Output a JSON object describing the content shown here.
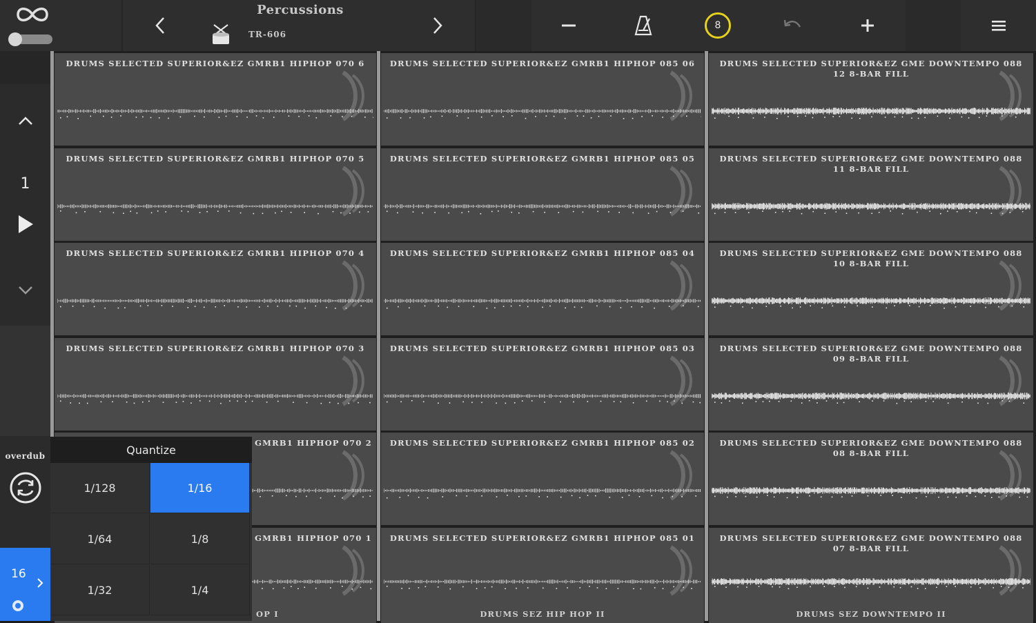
{
  "header": {
    "title": "Percussions",
    "kit_name": "TR-606",
    "tempo_beat": "8"
  },
  "sidebar": {
    "loop_number": "1",
    "overdub_label": "overdub",
    "step_count": "16"
  },
  "quantize": {
    "title": "Quantize",
    "options": [
      "1/128",
      "1/16",
      "1/64",
      "1/8",
      "1/32",
      "1/4"
    ],
    "selected": "1/16"
  },
  "columns": [
    {
      "cells": [
        "DRUMS SELECTED SUPERIOR&EZ GMRB1 HIPHOP 070 6",
        "DRUMS SELECTED SUPERIOR&EZ GMRB1 HIPHOP 070 5",
        "DRUMS SELECTED SUPERIOR&EZ GMRB1 HIPHOP 070 4",
        "DRUMS SELECTED SUPERIOR&EZ GMRB1 HIPHOP 070 3",
        "GMRB1 HIPHOP 070 2",
        "GMRB1 HIPHOP 070 1"
      ],
      "footer": "OP I"
    },
    {
      "cells": [
        "DRUMS SELECTED SUPERIOR&EZ GMRB1 HIPHOP 085 06",
        "DRUMS SELECTED SUPERIOR&EZ GMRB1 HIPHOP 085 05",
        "DRUMS SELECTED SUPERIOR&EZ GMRB1 HIPHOP 085 04",
        "DRUMS SELECTED SUPERIOR&EZ GMRB1 HIPHOP 085 03",
        "DRUMS SELECTED SUPERIOR&EZ GMRB1 HIPHOP 085 02",
        "DRUMS SELECTED SUPERIOR&EZ GMRB1 HIPHOP 085 01"
      ],
      "footer": "DRUMS SEZ HIP HOP II"
    },
    {
      "cells": [
        "DRUMS SELECTED SUPERIOR&EZ GME DOWNTEMPO 088 12 8-BAR FILL",
        "DRUMS SELECTED SUPERIOR&EZ GME DOWNTEMPO 088 11 8-BAR FILL",
        "DRUMS SELECTED SUPERIOR&EZ GME DOWNTEMPO 088 10 8-BAR FILL",
        "DRUMS SELECTED SUPERIOR&EZ GME DOWNTEMPO 088 09 8-BAR FILL",
        "DRUMS SELECTED SUPERIOR&EZ GME DOWNTEMPO 088 08 8-BAR FILL",
        "DRUMS SELECTED SUPERIOR&EZ GME DOWNTEMPO 088 07 8-BAR FILL"
      ],
      "footer": "DRUMS SEZ DOWNTEMPO II"
    }
  ],
  "colors": {
    "accent_blue": "#2a7bf0",
    "tempo_ring": "#e6d21a",
    "cell_bg": "#4a4a4a"
  },
  "icons": [
    "loop-icon",
    "toggle-switch",
    "chevron-left-icon",
    "drum-icon",
    "chevron-right-icon",
    "minus-icon",
    "metronome-icon",
    "undo-icon",
    "plus-icon",
    "menu-icon",
    "chevron-up-icon",
    "play-icon",
    "chevron-down-icon",
    "overdub-icon",
    "chevron-right-small-icon",
    "settings-dot-icon"
  ]
}
